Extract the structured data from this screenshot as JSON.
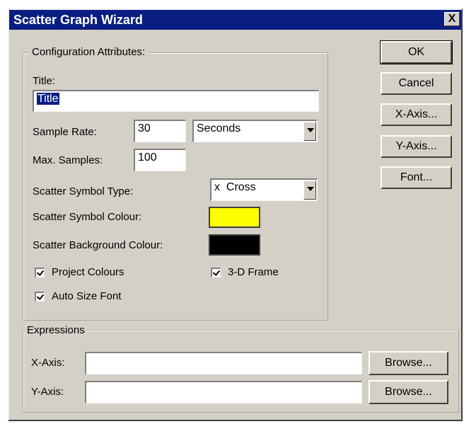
{
  "window": {
    "title": "Scatter Graph Wizard",
    "close_glyph": "X"
  },
  "config": {
    "group_label": "Configuration Attributes:",
    "title_label": "Title:",
    "title_value": "Title",
    "sample_rate_label": "Sample Rate:",
    "sample_rate_value": "30",
    "sample_rate_unit": "Seconds",
    "max_samples_label": "Max. Samples:",
    "max_samples_value": "100",
    "symbol_type_label": "Scatter Symbol Type:",
    "symbol_type_value": "x  Cross",
    "symbol_colour_label": "Scatter Symbol Colour:",
    "symbol_colour": "#ffff00",
    "background_colour_label": "Scatter Background Colour:",
    "background_colour": "#000000",
    "project_colours_label": "Project Colours",
    "three_d_frame_label": "3-D Frame",
    "auto_size_font_label": "Auto Size Font"
  },
  "buttons": {
    "ok": "OK",
    "cancel": "Cancel",
    "x_axis": "X-Axis...",
    "y_axis": "Y-Axis...",
    "font": "Font..."
  },
  "expressions": {
    "group_label": "Expressions",
    "x_axis_label": "X-Axis:",
    "x_axis_value": "",
    "y_axis_label": "Y-Axis:",
    "y_axis_value": "",
    "browse_label": "Browse..."
  }
}
